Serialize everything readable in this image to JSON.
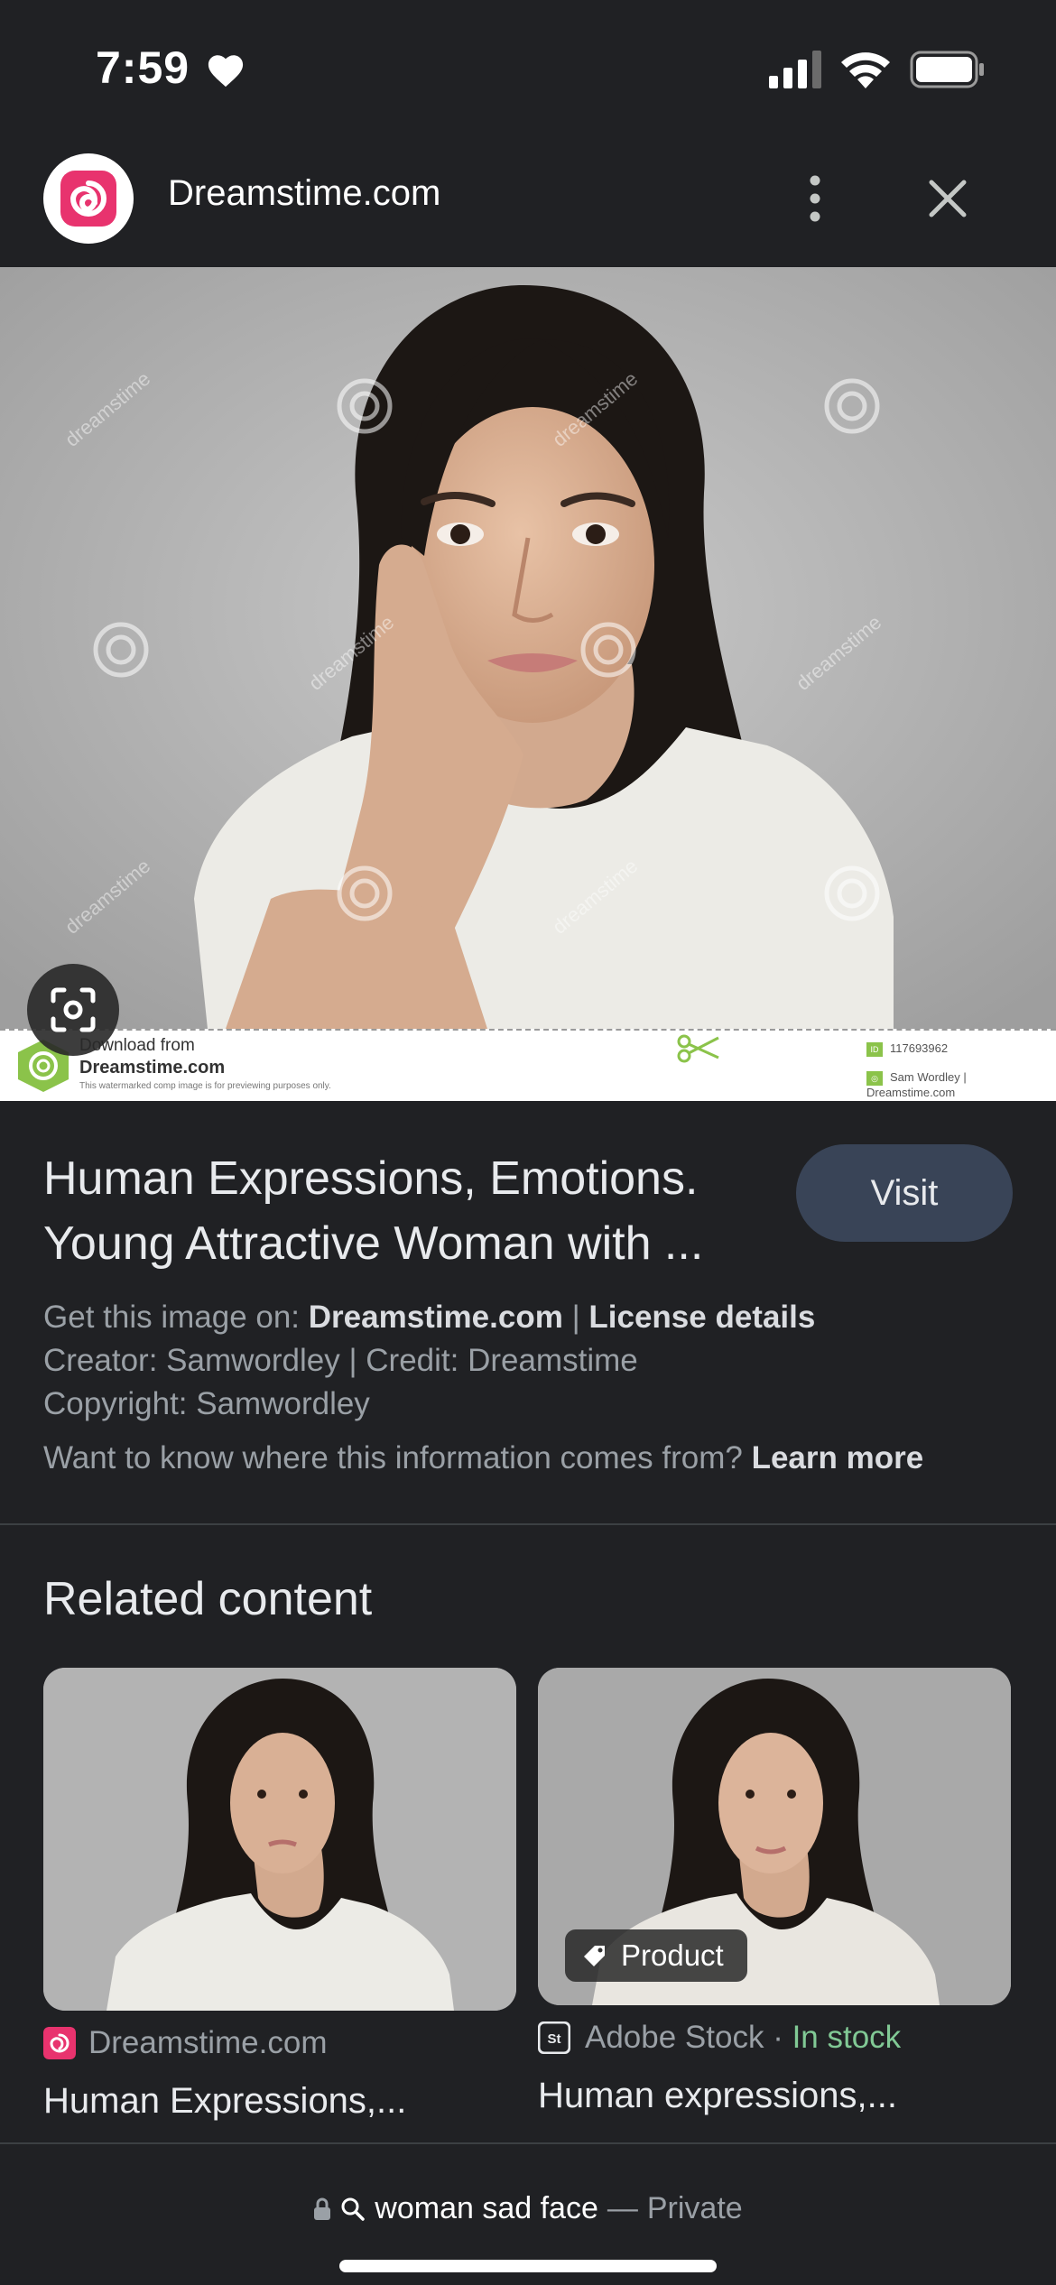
{
  "status": {
    "time": "7:59"
  },
  "header": {
    "site_name": "Dreamstime.com"
  },
  "watermark": {
    "download_from": "Download from",
    "site": "Dreamstime.com",
    "note": "This watermarked comp image is for previewing purposes only.",
    "id_badge": "ID",
    "id": "117693962",
    "credit": "Sam Wordley | Dreamstime.com"
  },
  "result": {
    "title_line1": "Human Expressions, Emotions.",
    "title_line2": "Young Attractive Woman with ...",
    "visit_label": "Visit",
    "get_image_prefix": "Get this image on: ",
    "get_image_site": "Dreamstime.com",
    "separator": " | ",
    "license_link": "License details",
    "creator_line": "Creator: Samwordley | Credit: Dreamstime",
    "copyright_line": "Copyright: Samwordley",
    "info_question": "Want to know where this information comes from? ",
    "learn_more": "Learn more"
  },
  "related": {
    "heading": "Related content",
    "cards": [
      {
        "source": "Dreamstime.com",
        "title": "Human Expressions,..."
      },
      {
        "source": "Adobe Stock",
        "dot": " · ",
        "stock": "In stock",
        "chip": "Product",
        "title": "Human expressions,..."
      }
    ]
  },
  "bottom": {
    "query": "woman sad face",
    "dash": "—",
    "mode": "Private"
  },
  "colors": {
    "background": "#202124",
    "visit_button": "#394457",
    "in_stock": "#81c995",
    "brand": "#e8336e"
  }
}
